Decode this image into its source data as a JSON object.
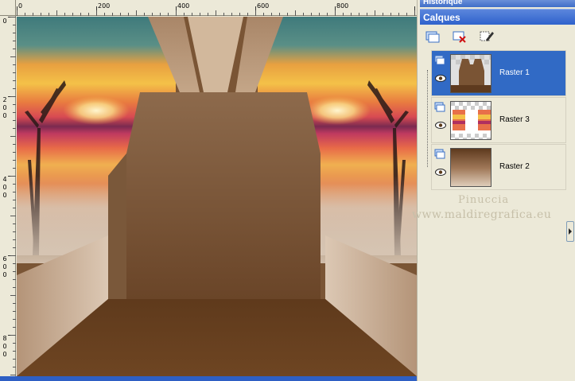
{
  "panels": {
    "history_title": "Historique",
    "layers_title": "Calques"
  },
  "ruler": {
    "top_labels": [
      "0",
      "200",
      "400",
      "600",
      "800"
    ],
    "left_labels": [
      [
        "0"
      ],
      [
        "2",
        "0",
        "0"
      ],
      [
        "4",
        "0",
        "0"
      ],
      [
        "6",
        "0",
        "0"
      ],
      [
        "8",
        "0",
        "0"
      ]
    ]
  },
  "toolbar": {
    "icons": [
      "new-layer-group-icon",
      "delete-layer-icon",
      "layer-properties-icon"
    ]
  },
  "layers": [
    {
      "name": "Raster 1",
      "selected": true,
      "visible": true
    },
    {
      "name": "Raster 3",
      "selected": false,
      "visible": true
    },
    {
      "name": "Raster 2",
      "selected": false,
      "visible": true
    }
  ],
  "watermark": {
    "line1": "Pinuccia",
    "line2": "www.maldiregrafica.eu"
  },
  "colors": {
    "panel_bg": "#ece9d8",
    "title_blue": "#2f62cc",
    "selected_blue": "#316ac5",
    "brown_dark": "#5e3a1e",
    "brown_light": "#c8a988"
  }
}
